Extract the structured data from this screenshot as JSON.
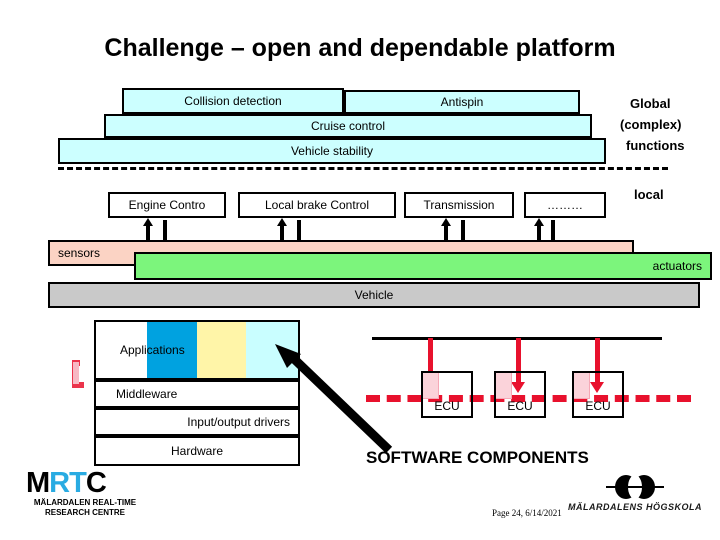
{
  "slide": {
    "title": "Challenge – open and dependable platform",
    "page_label": "Page 24, 6/14/2021"
  },
  "global_functions": {
    "side_label_line1": "Global",
    "side_label_line2": "(complex)",
    "side_label_line3": "functions",
    "layers": [
      {
        "label": "Collision detection"
      },
      {
        "label": "Antispin"
      },
      {
        "label": "Cruise control"
      },
      {
        "label": "Vehicle stability"
      }
    ]
  },
  "local_functions": {
    "side_label": "local",
    "controls": [
      {
        "label": "Engine Contro"
      },
      {
        "label": "Local brake Control"
      },
      {
        "label": "Transmission"
      },
      {
        "label": "………"
      }
    ]
  },
  "platform": {
    "sensors_label": "sensors",
    "actuators_label": "actuators",
    "vehicle_label": "Vehicle",
    "colors": {
      "sensors": "#fbd3c4",
      "actuators": "#7cf57c",
      "vehicle": "#c9c9c9",
      "function_box": "#ccffff"
    }
  },
  "software_stack": {
    "layers": [
      {
        "label": "Applications"
      },
      {
        "label": "Middleware"
      },
      {
        "label": "Input/output drivers"
      },
      {
        "label": "Hardware"
      }
    ],
    "application_components": [
      {
        "color": "#ffffff"
      },
      {
        "color": "#00a2e0"
      },
      {
        "color": "#fff5a8"
      },
      {
        "color": "#c9feff"
      }
    ]
  },
  "ecu_area": {
    "caption": "SOFTWARE COMPONENTS",
    "nodes": [
      {
        "label": "ECU"
      },
      {
        "label": "ECU"
      },
      {
        "label": "ECU"
      }
    ],
    "accent_color": "#e8112d"
  },
  "logos": {
    "mrtc": {
      "mark_m": "M",
      "mark_rt": "RT",
      "mark_c": "C",
      "sub_line1": "MÄLARDALEN REAL-TIME",
      "sub_line2": "RESEARCH CENTRE"
    },
    "mdh": {
      "sub": "MÄLARDALENS HÖGSKOLA"
    }
  }
}
